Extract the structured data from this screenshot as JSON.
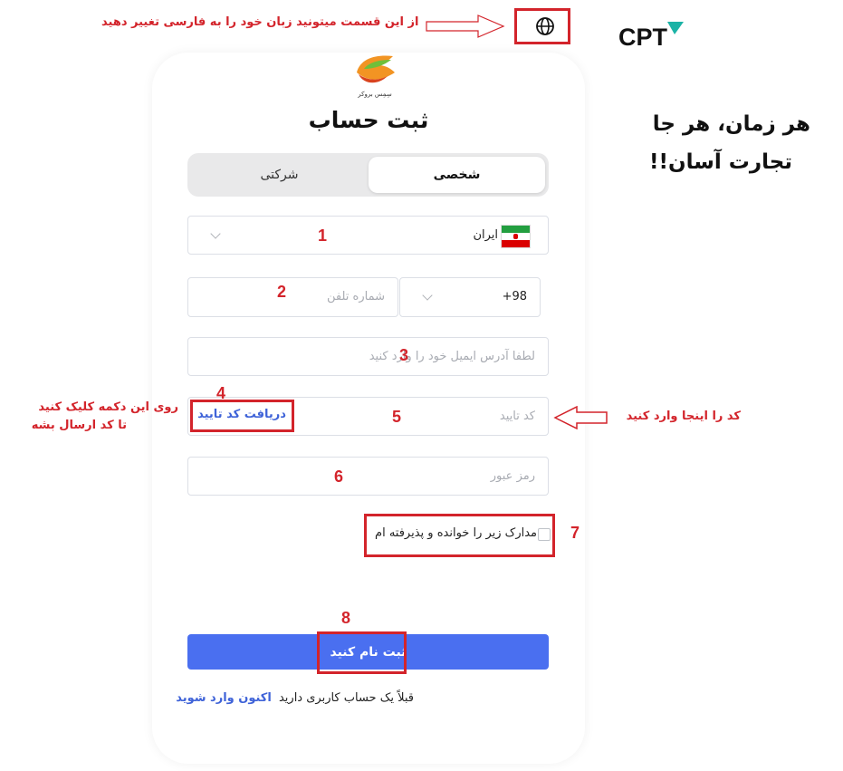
{
  "annotations": {
    "language_hint": "از این قسمت میتونید زبان خود را به فارسی تغییر دهید",
    "code_button_hint_line1": "روی این دکمه کلیک کنید",
    "code_button_hint_line2": "تا کد ارسال بشه",
    "code_field_hint": "کد را اینجا وارد کنید",
    "numbers": [
      "1",
      "2",
      "3",
      "4",
      "5",
      "6",
      "7",
      "8"
    ]
  },
  "brand": {
    "logo_text": "CPT",
    "site_logo_caption": "سِمِس بروکر"
  },
  "slogan": {
    "line1": "هر زمان، هر جا",
    "line2": "تجارت آسان!!"
  },
  "form": {
    "title": "ثبت حساب",
    "tabs": {
      "personal": "شخصی",
      "company": "شرکتی"
    },
    "country": {
      "value": "ایران",
      "flag": "iran-flag"
    },
    "phone": {
      "code": "+98",
      "placeholder": "شماره تلفن"
    },
    "email": {
      "placeholder": "لطفا آدرس ایمیل خود را وارد کنید"
    },
    "verification": {
      "placeholder": "کد تایید",
      "get_code_label": "دریافت کد تایید"
    },
    "password": {
      "placeholder": "رمز عبور"
    },
    "terms_label": "مدارک زیر را خوانده و پذیرفته ام",
    "submit_label": "ثبت نام کنید",
    "login_prompt": "قبلاً یک حساب کاربری دارید",
    "login_link": "اکنون وارد شوید"
  },
  "colors": {
    "accent": "#4a6ff0",
    "annotation_red": "#d3242b",
    "cpt_teal": "#1bb3a6"
  }
}
